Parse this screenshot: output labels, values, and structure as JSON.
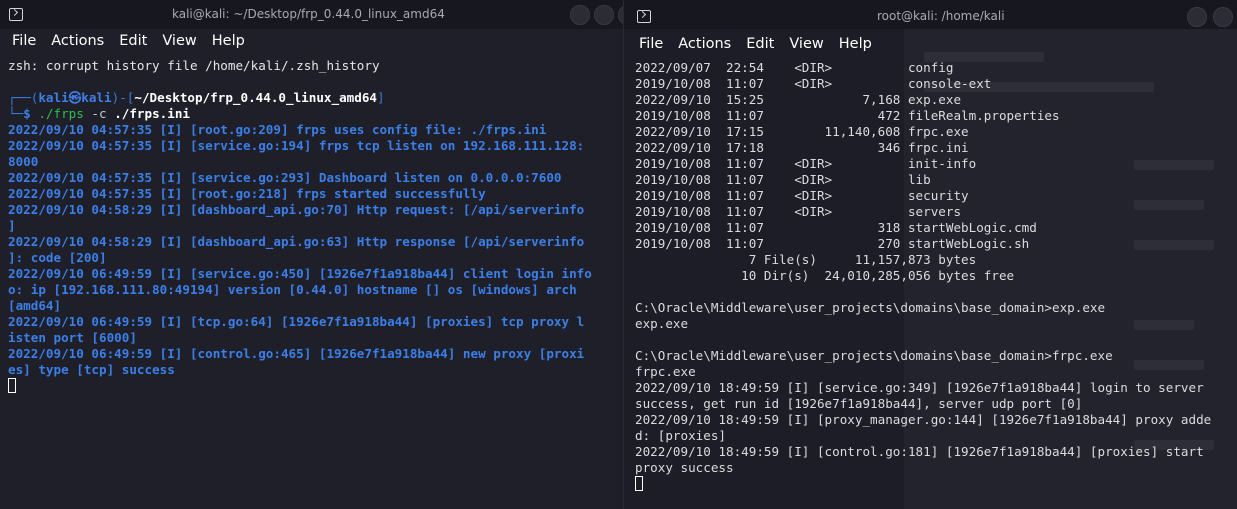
{
  "left": {
    "title": "kali@kali: ~/Desktop/frp_0.44.0_linux_amd64",
    "menu": [
      "File",
      "Actions",
      "Edit",
      "View",
      "Help"
    ],
    "zsh_warning": "zsh: corrupt history file /home/kali/.zsh_history",
    "prompt": {
      "top_open": "┌──(",
      "user": "kali㉿kali",
      "mid": ")-[",
      "path": "~/Desktop/frp_0.44.0_linux_amd64",
      "close": "]",
      "bottom": "└─",
      "dollar": "$ ",
      "cmd": "./frps",
      "flag": " -c ",
      "arg": "./frps.ini"
    },
    "log": [
      "2022/09/10 04:57:35 [I] [root.go:209] frps uses config file: ./frps.ini",
      "2022/09/10 04:57:35 [I] [service.go:194] frps tcp listen on 192.168.111.128:",
      "8000",
      "2022/09/10 04:57:35 [I] [service.go:293] Dashboard listen on 0.0.0.0:7600",
      "2022/09/10 04:57:35 [I] [root.go:218] frps started successfully",
      "2022/09/10 04:58:29 [I] [dashboard_api.go:70] Http request: [/api/serverinfo",
      "]",
      "2022/09/10 04:58:29 [I] [dashboard_api.go:63] Http response [/api/serverinfo",
      "]: code [200]",
      "2022/09/10 06:49:59 [I] [service.go:450] [1926e7f1a918ba44] client login info",
      "o: ip [192.168.111.80:49194] version [0.44.0] hostname [] os [windows] arch",
      "[amd64]",
      "2022/09/10 06:49:59 [I] [tcp.go:64] [1926e7f1a918ba44] [proxies] tcp proxy l",
      "isten port [6000]",
      "2022/09/10 06:49:59 [I] [control.go:465] [1926e7f1a918ba44] new proxy [proxi",
      "es] type [tcp] success"
    ]
  },
  "right": {
    "title": "root@kali: /home/kali",
    "menu": [
      "File",
      "Actions",
      "Edit",
      "View",
      "Help"
    ],
    "lines": [
      "2022/09/07  22:54    <DIR>          config",
      "2019/10/08  11:07    <DIR>          console-ext",
      "2022/09/10  15:25             7,168 exp.exe",
      "2019/10/08  11:07               472 fileRealm.properties",
      "2022/09/10  17:15        11,140,608 frpc.exe",
      "2022/09/10  17:18               346 frpc.ini",
      "2019/10/08  11:07    <DIR>          init-info",
      "2019/10/08  11:07    <DIR>          lib",
      "2019/10/08  11:07    <DIR>          security",
      "2019/10/08  11:07    <DIR>          servers",
      "2019/10/08  11:07               318 startWebLogic.cmd",
      "2019/10/08  11:07               270 startWebLogic.sh",
      "               7 File(s)     11,157,873 bytes",
      "              10 Dir(s)  24,010,285,056 bytes free",
      "",
      "C:\\Oracle\\Middleware\\user_projects\\domains\\base_domain>exp.exe",
      "exp.exe",
      "",
      "C:\\Oracle\\Middleware\\user_projects\\domains\\base_domain>frpc.exe",
      "frpc.exe",
      "2022/09/10 18:49:59 [I] [service.go:349] [1926e7f1a918ba44] login to server",
      "success, get run id [1926e7f1a918ba44], server udp port [0]",
      "2022/09/10 18:49:59 [I] [proxy_manager.go:144] [1926e7f1a918ba44] proxy adde",
      "d: [proxies]",
      "2022/09/10 18:49:59 [I] [control.go:181] [1926e7f1a918ba44] [proxies] start",
      "proxy success"
    ]
  }
}
